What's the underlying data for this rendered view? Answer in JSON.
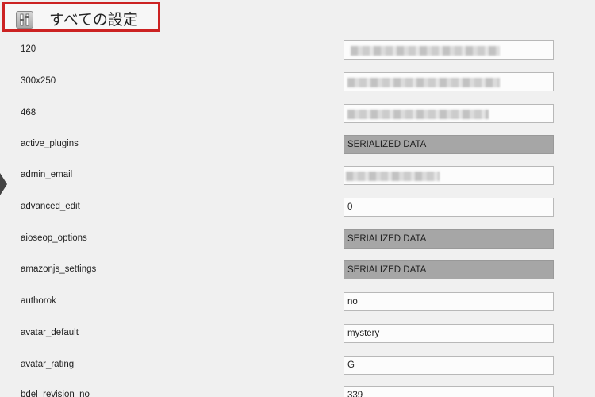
{
  "header": {
    "title": "すべての設定",
    "icon": "settings-icon"
  },
  "rows": [
    {
      "label": "120",
      "value": "",
      "type": "blurred"
    },
    {
      "label": "300x250",
      "value": "",
      "type": "blurred"
    },
    {
      "label": "468",
      "value": "",
      "type": "blurred"
    },
    {
      "label": "active_plugins",
      "value": "SERIALIZED DATA",
      "type": "serialized"
    },
    {
      "label": "admin_email",
      "value": "",
      "type": "blurred"
    },
    {
      "label": "advanced_edit",
      "value": "0",
      "type": "text"
    },
    {
      "label": "aioseop_options",
      "value": "SERIALIZED DATA",
      "type": "serialized"
    },
    {
      "label": "amazonjs_settings",
      "value": "SERIALIZED DATA",
      "type": "serialized"
    },
    {
      "label": "authorok",
      "value": "no",
      "type": "text"
    },
    {
      "label": "avatar_default",
      "value": "mystery",
      "type": "text"
    },
    {
      "label": "avatar_rating",
      "value": "G",
      "type": "text"
    },
    {
      "label": "bdel_revision_no",
      "value": "339",
      "type": "text"
    }
  ]
}
